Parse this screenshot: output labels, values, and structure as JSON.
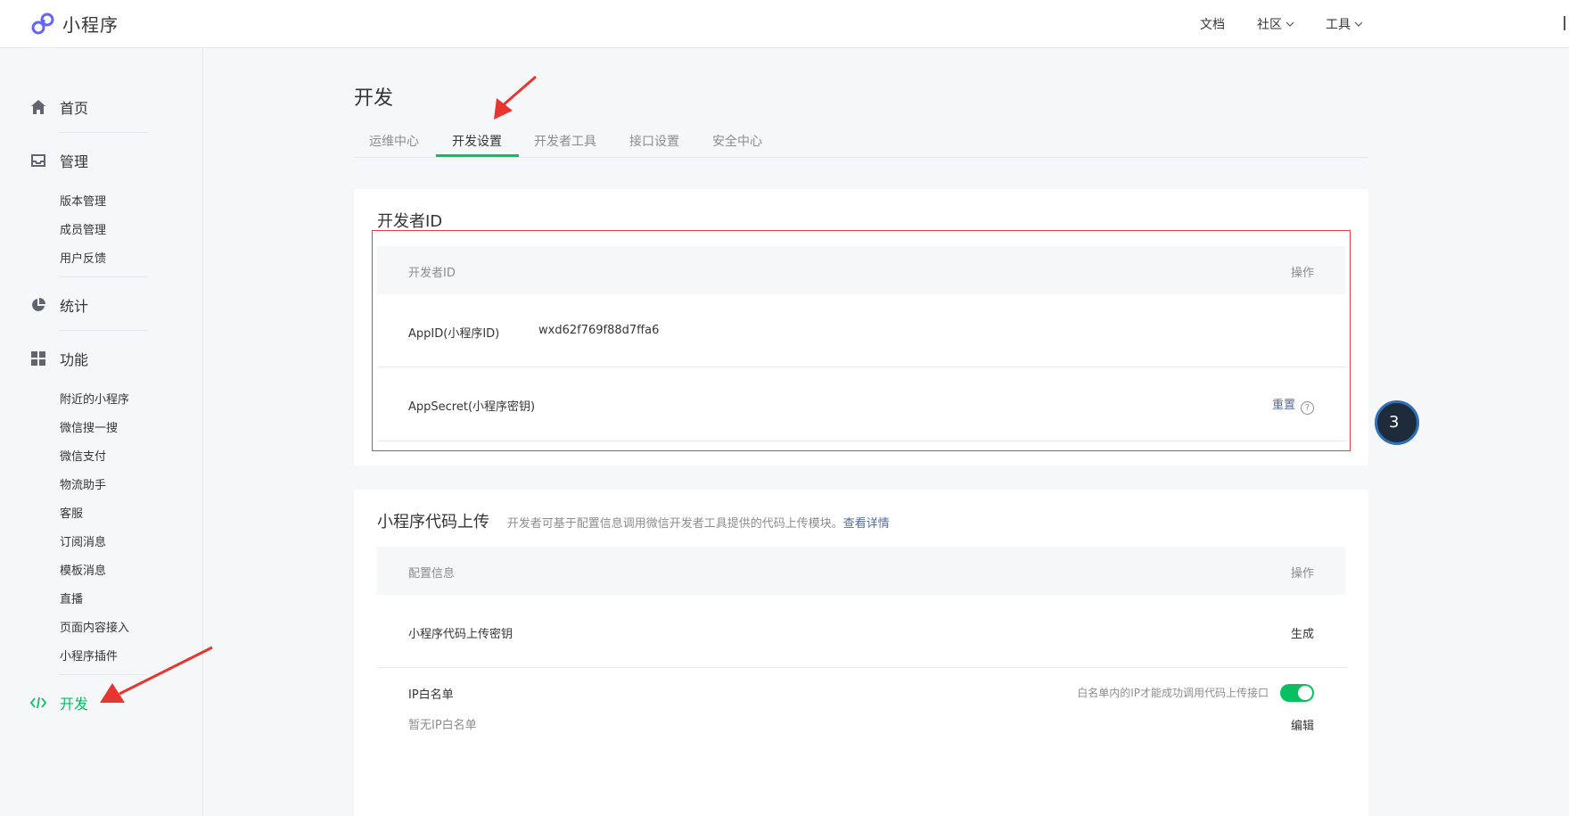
{
  "topbar": {
    "logo_text": "小程序",
    "nav": {
      "docs": "文档",
      "community": "社区",
      "tools": "工具"
    }
  },
  "sidebar": {
    "home": "首页",
    "manage": "管理",
    "manage_items": [
      "版本管理",
      "成员管理",
      "用户反馈"
    ],
    "stats": "统计",
    "features": "功能",
    "feature_items": [
      "附近的小程序",
      "微信搜一搜",
      "微信支付",
      "物流助手",
      "客服",
      "订阅消息",
      "模板消息",
      "直播",
      "页面内容接入",
      "小程序插件"
    ],
    "develop": "开发"
  },
  "main": {
    "title": "开发",
    "tabs": [
      "运维中心",
      "开发设置",
      "开发者工具",
      "接口设置",
      "安全中心"
    ],
    "active_tab": "开发设置"
  },
  "developer_id": {
    "title": "开发者ID",
    "col_left": "开发者ID",
    "col_right": "操作",
    "appid_label": "AppID(小程序ID)",
    "appid_value": "wxd62f769f88d7ffa6",
    "secret_label": "AppSecret(小程序密钥)",
    "reset": "重置",
    "help": "?"
  },
  "upload": {
    "title": "小程序代码上传",
    "desc": "开发者可基于配置信息调用微信开发者工具提供的代码上传模块。",
    "detail_link": "查看详情",
    "col_left": "配置信息",
    "col_right": "操作",
    "key_label": "小程序代码上传密钥",
    "generate": "生成",
    "ip_label": "IP白名单",
    "ip_note": "白名单内的IP才能成功调用代码上传接口",
    "ip_empty": "暂无IP白名单",
    "edit": "编辑",
    "ip_toggle_on": true
  },
  "float_badge": "3",
  "colors": {
    "accent": "#07c160",
    "link": "#576b95",
    "highlight": "#e64340",
    "arrow": "#e8352f"
  }
}
